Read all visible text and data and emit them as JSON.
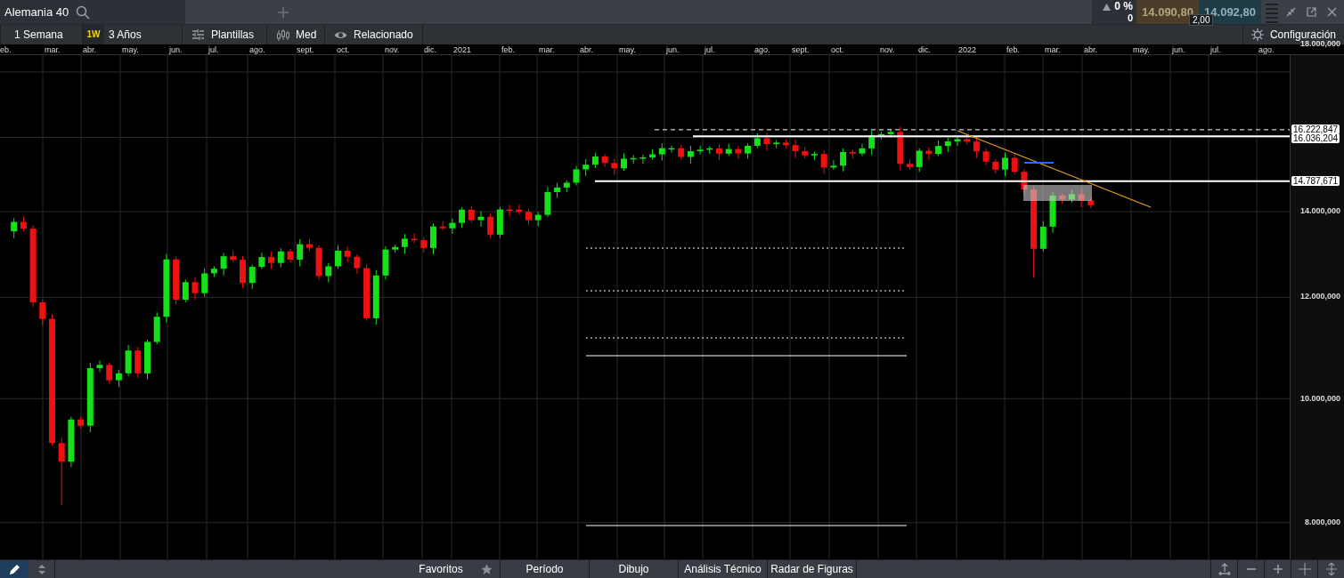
{
  "instrument_tab": {
    "title": "Alemania 40"
  },
  "quote": {
    "rising": true,
    "change": "0 %",
    "volume": "0",
    "sell": "14.090,80",
    "buy": "14.092,80",
    "spread": "2,00"
  },
  "toolbar": {
    "interval": "1 Semana",
    "interval_badge": "1W",
    "range": "3 Años",
    "buttons": [
      {
        "label": "Plantillas",
        "kind": "templates"
      },
      {
        "label": "Med",
        "kind": "candles"
      },
      {
        "label": "Relacionado",
        "kind": "related"
      }
    ],
    "settings": "Configuración"
  },
  "chart": {
    "months": [
      "eb.",
      "mar.",
      "abr.",
      "may.",
      "jun.",
      "jul.",
      "ago.",
      "sept.",
      "oct.",
      "nov.",
      "dic.",
      "2021",
      "feb.",
      "mar.",
      "abr.",
      "may.",
      "jun.",
      "jul.",
      "ago.",
      "sept.",
      "oct.",
      "nov.",
      "dic.",
      "2022",
      "feb.",
      "mar.",
      "abr.",
      "may.",
      "jun.",
      "jul.",
      "ago."
    ],
    "price_ticks": [
      "18.000,000",
      "14.000,000",
      "12.000,000",
      "10.000,000",
      "8.000,000"
    ],
    "level_labels": [
      "16.222,847",
      "16.036,204",
      "14.787,671"
    ]
  },
  "bottom_tabs": [
    "Favoritos",
    "Período",
    "Dibujo",
    "Análisis Técnico",
    "Radar de Figuras"
  ]
}
